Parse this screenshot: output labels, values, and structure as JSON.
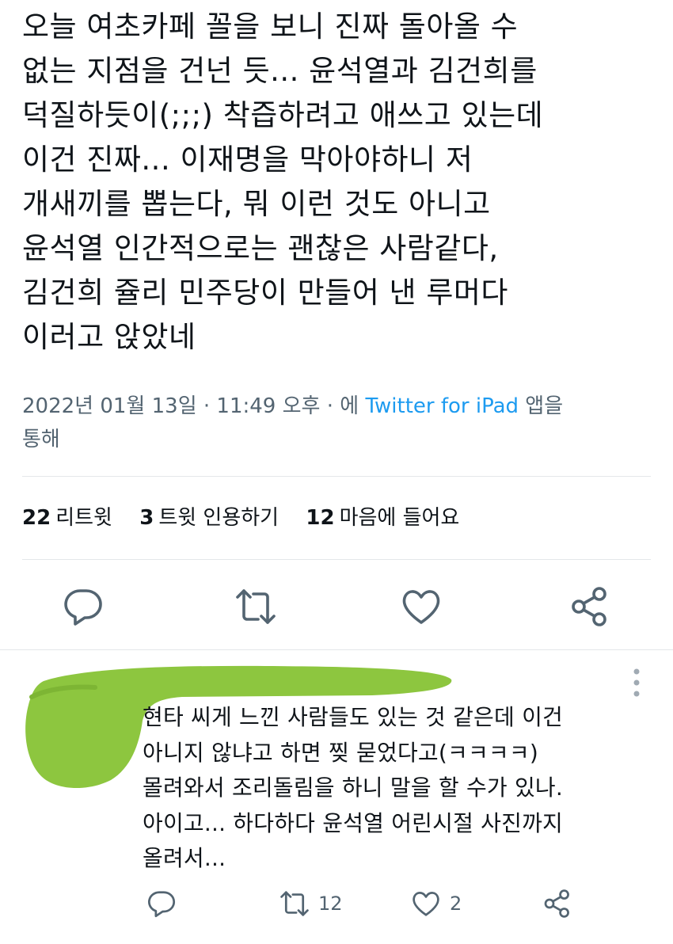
{
  "tweet": {
    "lines": [
      "오늘 여초카페 꼴을 보니 진짜 돌아올 수",
      "없는 지점을 건넌 듯... 윤석열과 김건희를",
      "덕질하듯이(;;;) 착즙하려고 애쓰고 있는데",
      "이건 진짜... 이재명을 막아야하니 저",
      "개새끼를 뽑는다, 뭐 이런 것도 아니고",
      "윤석열 인간적으로는 괜찮은 사람같다,",
      "김건희 쥴리 민주당이 만들어 낸 루머다",
      "이러고 앉았네"
    ],
    "meta_date": "2022년 01월 13일 · 11:49 오후 · 에 ",
    "meta_source": "Twitter for iPad",
    "meta_suffix": " 앱을",
    "meta_line2": "통해"
  },
  "stats": {
    "retweets_count": "22",
    "retweets_label": "리트윗",
    "quotes_count": "3",
    "quotes_label": "트윗 인용하기",
    "likes_count": "12",
    "likes_label": "마음에 들어요"
  },
  "actions": {
    "reply_icon": "reply-icon",
    "retweet_icon": "retweet-icon",
    "like_icon": "heart-icon",
    "share_icon": "share-icon"
  },
  "reply": {
    "lines": [
      "현타 씨게 느낀 사람들도 있는 것 같은데 이건",
      "아니지 않냐고 하면 찢 묻었다고(ㅋㅋㅋㅋ)",
      "몰려와서 조리돌림을 하니 말을 할 수가 있나.",
      "아이고... 하다하다 윤석열 어린시절 사진까지",
      "올려서..."
    ],
    "retweet_count": "12",
    "like_count": "2"
  },
  "colors": {
    "text": "#0f1419",
    "muted": "#536471",
    "link": "#1d9bf0",
    "redaction": "#8dc63f",
    "divider": "#e4e7ea"
  }
}
